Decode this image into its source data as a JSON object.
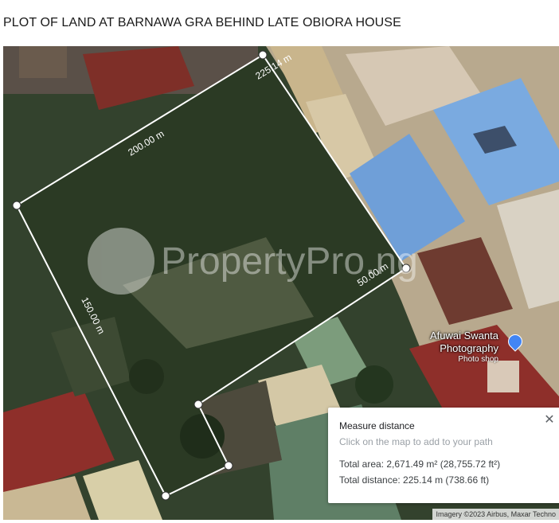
{
  "page": {
    "title": "PLOT OF LAND AT BARNAWA GRA BEHIND LATE OBIORA HOUSE"
  },
  "map": {
    "watermark": "PropertyPro.ng",
    "poi": {
      "name_line1": "Afuwai Swanta",
      "name_line2": "Photography",
      "type": "Photo shop",
      "icon": "photo-shop-pin-icon"
    },
    "attribution": "Imagery ©2023 Airbus, Maxar Techno",
    "measure_labels": {
      "top": "225.14 m",
      "upper_left": "200.00 m",
      "right": "50.00 m",
      "left": "150.00 m"
    },
    "colors": {
      "measure_line": "#ffffff",
      "roof_blue": "#6f9fd8",
      "roof_red": "#8e2f2a",
      "vegetation": "#2b3a24"
    }
  },
  "measure_card": {
    "title": "Measure distance",
    "subtitle": "Click on the map to add to your path",
    "total_area": "Total area: 2,671.49 m² (28,755.72 ft²)",
    "total_distance": "Total distance: 225.14 m (738.66 ft)",
    "close_icon": "close-icon"
  }
}
